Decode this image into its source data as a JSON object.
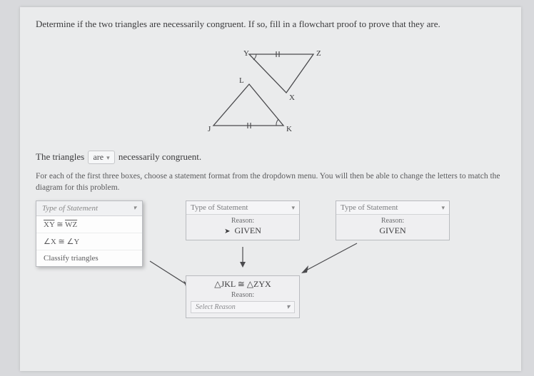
{
  "prompt": "Determine if the two triangles are necessarily congruent. If so, fill in a flowchart proof to prove that they are.",
  "diagram": {
    "points_upper": [
      "Y",
      "Z",
      "X"
    ],
    "points_lower": [
      "J",
      "L",
      "K"
    ]
  },
  "sentence": {
    "prefix": "The triangles",
    "dd_value": "are",
    "suffix": "necessarily congruent."
  },
  "instructions": "For each of the first three boxes, choose a statement format from the dropdown menu. You will then be able to change the letters to match the diagram for this problem.",
  "dropdown": {
    "header": "Type of Statement",
    "options": [
      "XY ≅ WZ",
      "∠X ≅ ∠Y",
      "Classify triangles"
    ]
  },
  "box2": {
    "type_label": "Type of Statement",
    "reason_label": "Reason:",
    "reason_value": "GIVEN"
  },
  "box3": {
    "type_label": "Type of Statement",
    "reason_label": "Reason:",
    "reason_value": "GIVEN"
  },
  "conclusion": {
    "statement": "△JKL ≅ △ZYX",
    "reason_label": "Reason:",
    "select_placeholder": "Select Reason"
  }
}
